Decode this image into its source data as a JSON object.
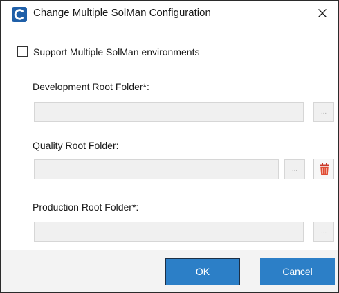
{
  "dialog": {
    "title": "Change Multiple SolMan Configuration",
    "app_icon": "c-logo-icon",
    "close_icon": "close-icon"
  },
  "support": {
    "label": "Support Multiple SolMan environments",
    "checked": false
  },
  "fields": [
    {
      "label": "Development Root Folder*:",
      "value": "",
      "browse_label": "..."
    },
    {
      "label": "Quality Root Folder:",
      "value": "",
      "browse_label": "...",
      "delete_icon": "trash-icon"
    },
    {
      "label": "Production Root Folder*:",
      "value": "",
      "browse_label": "..."
    }
  ],
  "footer": {
    "ok_label": "OK",
    "cancel_label": "Cancel"
  },
  "colors": {
    "primary_button": "#2c7fc7",
    "app_icon": "#1f5fa8",
    "delete_icon": "#d9442c",
    "input_background": "#f0f0f0"
  }
}
